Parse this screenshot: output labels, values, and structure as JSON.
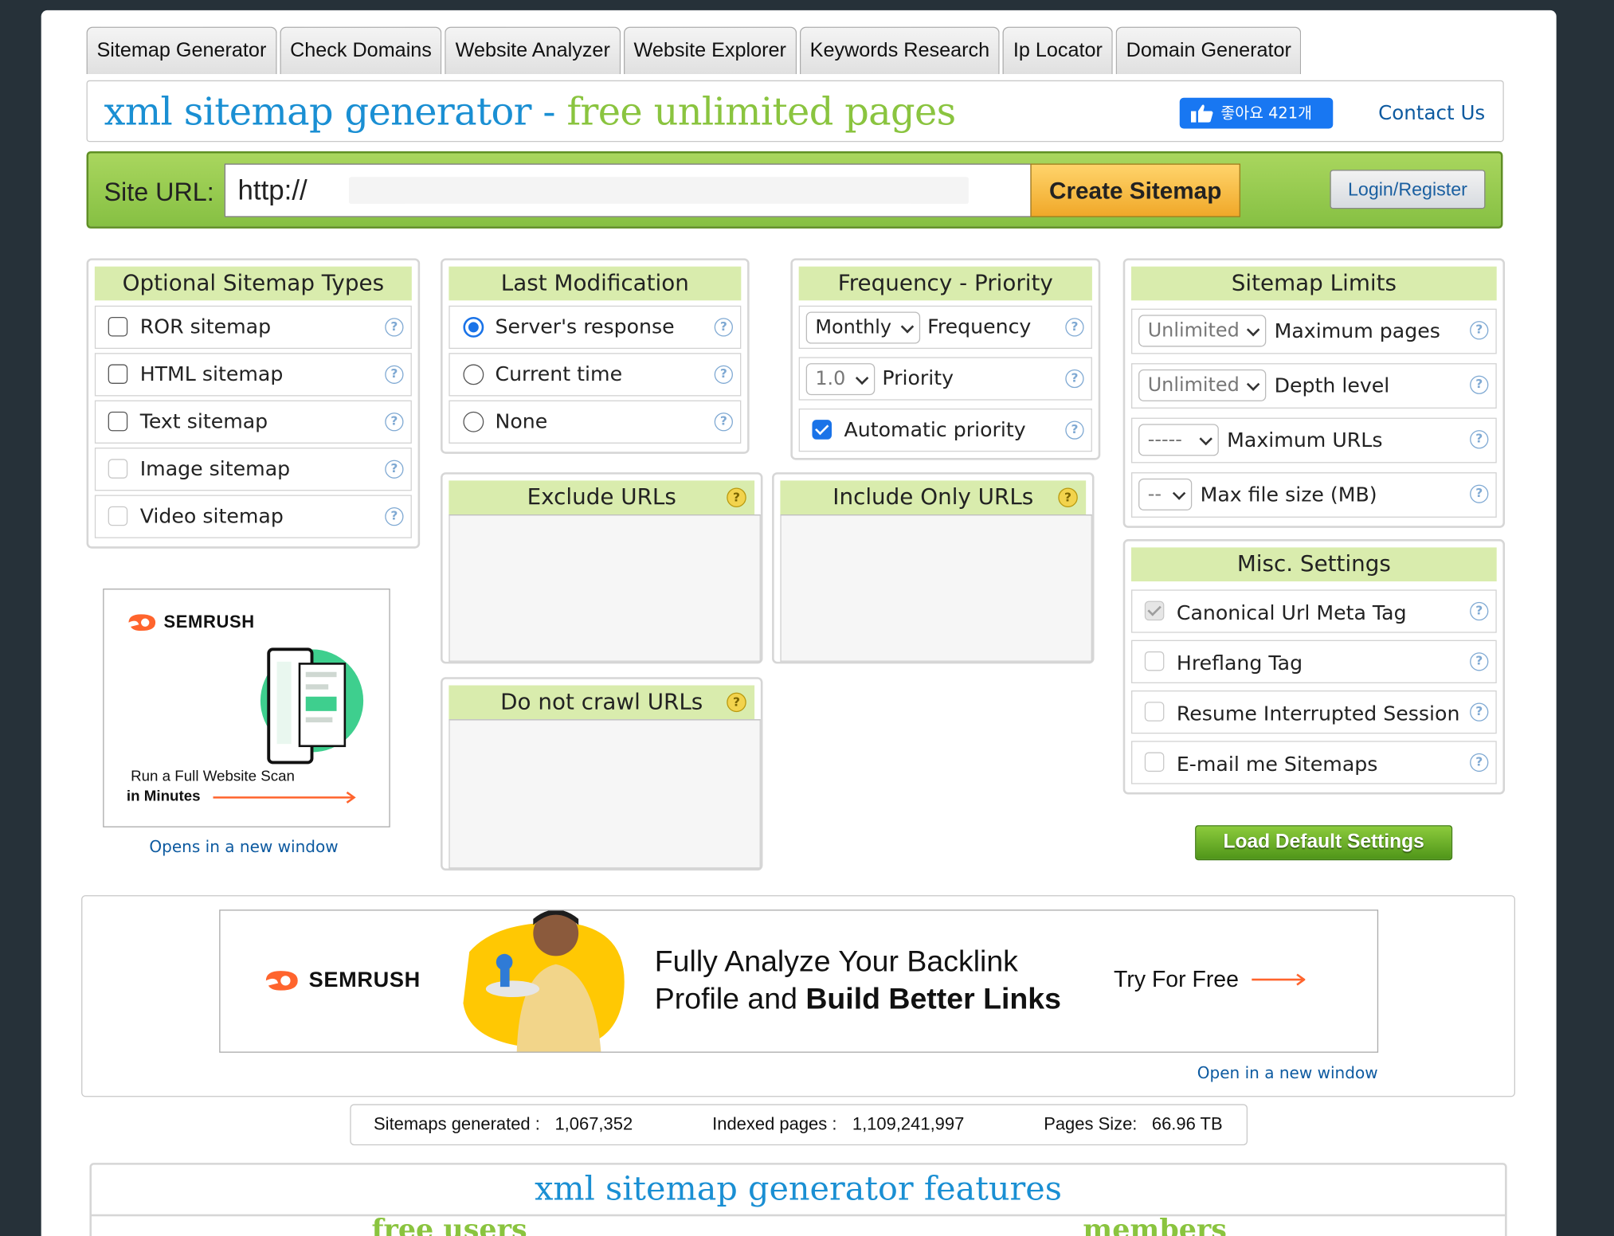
{
  "nav": {
    "tabs": [
      "Sitemap Generator",
      "Check Domains",
      "Website Analyzer",
      "Website Explorer",
      "Keywords Research",
      "Ip Locator",
      "Domain Generator"
    ]
  },
  "header": {
    "title_part1": "xml sitemap generator -",
    "title_part2": "free unlimited pages",
    "like_label": "좋아요 421개",
    "contact_label": "Contact Us"
  },
  "urlbar": {
    "label": "Site URL:",
    "value": "http://",
    "create_label": "Create Sitemap",
    "login_label": "Login/Register"
  },
  "optional_types": {
    "title": "Optional Sitemap Types",
    "items": [
      "ROR sitemap",
      "HTML sitemap",
      "Text sitemap",
      "Image sitemap",
      "Video sitemap"
    ]
  },
  "last_modification": {
    "title": "Last Modification",
    "options": [
      "Server's response",
      "Current time",
      "None"
    ],
    "selected": "Server's response"
  },
  "frequency": {
    "title": "Frequency - Priority",
    "frequency_value": "Monthly",
    "frequency_label": "Frequency",
    "priority_value": "1.0",
    "priority_label": "Priority",
    "auto_label": "Automatic priority"
  },
  "limits": {
    "title": "Sitemap Limits",
    "max_pages_value": "Unlimited",
    "max_pages_label": "Maximum pages",
    "depth_value": "Unlimited",
    "depth_label": "Depth level",
    "max_urls_value": "-----",
    "max_urls_label": "Maximum URLs",
    "file_size_value": "--",
    "file_size_label": "Max file size (MB)"
  },
  "exclude": {
    "title": "Exclude URLs"
  },
  "include": {
    "title": "Include Only URLs"
  },
  "nocrawl": {
    "title": "Do not crawl URLs"
  },
  "misc": {
    "title": "Misc. Settings",
    "items": [
      "Canonical Url Meta Tag",
      "Hreflang Tag",
      "Resume Interrupted Session",
      "E-mail me Sitemaps"
    ]
  },
  "ad_small": {
    "brand": "SEMRUSH",
    "line1": "Run a Full Website Scan",
    "line2": "in Minutes",
    "link": "Opens in a new window"
  },
  "load_default_label": "Load Default Settings",
  "ad_big": {
    "brand": "SEMRUSH",
    "line1": "Fully Analyze Your Backlink",
    "line2a": "Profile and ",
    "line2b": "Build Better Links",
    "cta": "Try For Free",
    "link": "Open in a new window"
  },
  "stats": {
    "generated_label": "Sitemaps generated :",
    "generated_value": "1,067,352",
    "indexed_label": "Indexed pages :",
    "indexed_value": "1,109,241,997",
    "size_label": "Pages Size:",
    "size_value": "66.96 TB"
  },
  "features": {
    "title": "xml sitemap generator features",
    "free_label": "free users",
    "members_label": "members"
  },
  "colors": {
    "accent_blue": "#1a8fd3",
    "accent_green": "#8ac43f",
    "bar_green": "#9ccf52",
    "header_green": "#d9ecad"
  }
}
